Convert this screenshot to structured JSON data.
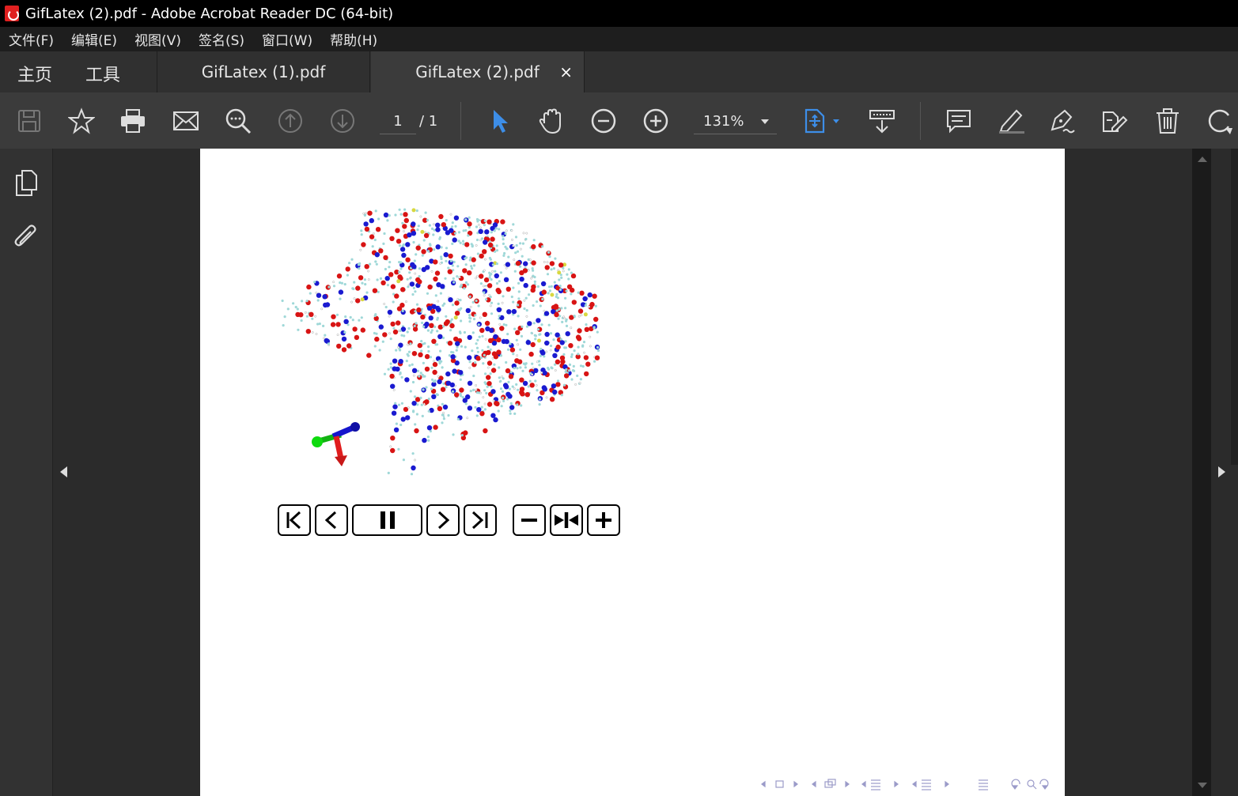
{
  "window": {
    "title": "GifLatex (2).pdf - Adobe Acrobat Reader DC (64-bit)"
  },
  "menu": [
    "文件(F)",
    "编辑(E)",
    "视图(V)",
    "签名(S)",
    "窗口(W)",
    "帮助(H)"
  ],
  "tabs": {
    "home": "主页",
    "tools": "工具",
    "docs": [
      {
        "label": "GifLatex (1).pdf",
        "active": false
      },
      {
        "label": "GifLatex (2).pdf",
        "active": true
      }
    ],
    "close_glyph": "×"
  },
  "toolbar": {
    "page_current": "1",
    "page_total": "/ 1",
    "zoom": "131%",
    "accent": "#3d8ee8"
  },
  "icons": [
    "save-icon",
    "star-icon",
    "print-icon",
    "mail-icon",
    "search-icon",
    "page-up-icon",
    "page-down-icon",
    "select-arrow-icon",
    "hand-icon",
    "zoom-out-icon",
    "zoom-in-icon",
    "fit-page-icon",
    "scroll-mode-icon",
    "comment-icon",
    "highlight-icon",
    "sign-icon",
    "edit-icon",
    "delete-icon",
    "rotate-icon"
  ],
  "animation_controls": [
    "first-frame",
    "previous-frame",
    "pause",
    "next-frame",
    "last-frame",
    "slower",
    "default-speed",
    "faster"
  ]
}
